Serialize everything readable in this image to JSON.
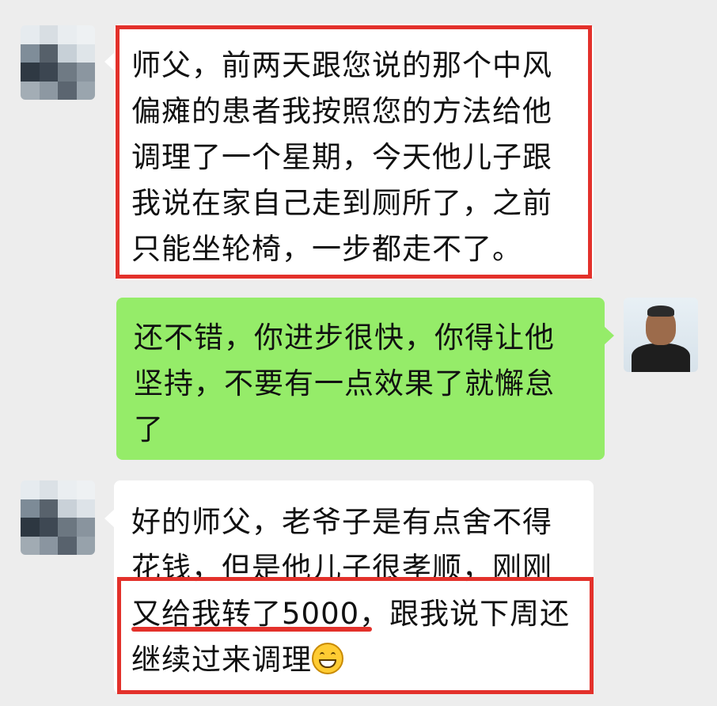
{
  "messages": [
    {
      "side": "left",
      "lines": [
        "师父，前两天跟您说的那个中风",
        "偏瘫的患者我按照您的方法给他",
        "调理了一个星期，今天他儿子跟",
        "我说在家自己走到厕所了，之前",
        "只能坐轮椅，一步都走不了。"
      ]
    },
    {
      "side": "right",
      "lines": [
        "还不错，你进步很快，你得让他",
        "坚持，不要有一点效果了就懈怠",
        "了"
      ]
    },
    {
      "side": "left",
      "lines": [
        "好的师父，老爷子是有点舍不得",
        "花钱，但是他儿子很孝顺，刚刚",
        "又给我转了5000，跟我说下周还",
        "继续过来调理"
      ]
    }
  ],
  "emoji": "grinning-face-icon",
  "colors": {
    "background": "#ededed",
    "incoming_bubble": "#ffffff",
    "outgoing_bubble": "#95ec69",
    "highlight": "#e3312b"
  }
}
